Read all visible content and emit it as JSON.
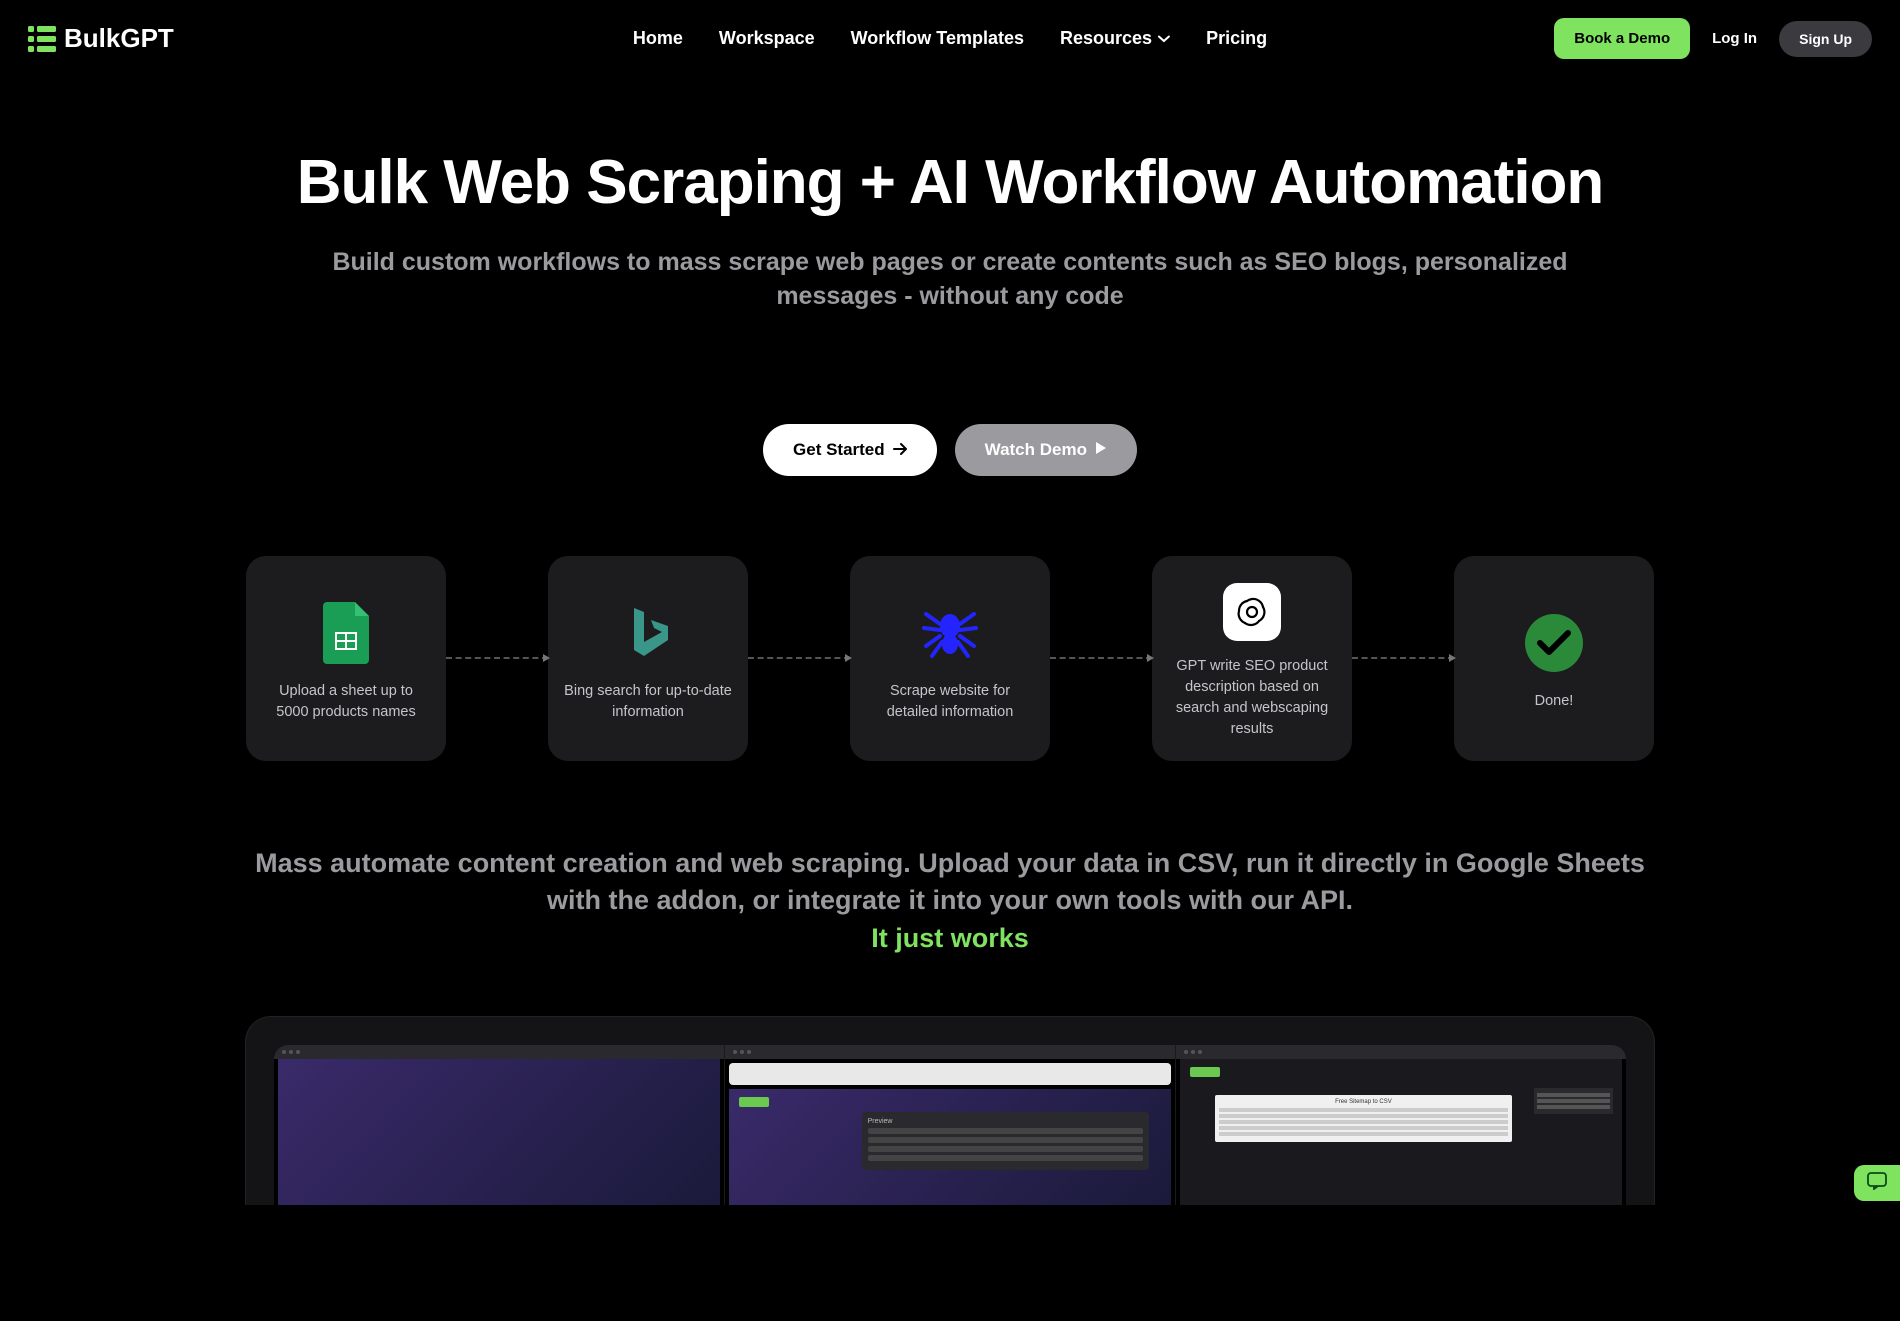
{
  "brand": "BulkGPT",
  "nav": {
    "home": "Home",
    "workspace": "Workspace",
    "templates": "Workflow Templates",
    "resources": "Resources",
    "pricing": "Pricing"
  },
  "header_actions": {
    "book_demo": "Book a Demo",
    "login": "Log In",
    "signup": "Sign Up"
  },
  "hero": {
    "title": "Bulk Web Scraping + AI Workflow Automation",
    "subtitle": "Build custom workflows to mass scrape web pages or create contents such as SEO blogs, personalized messages - without any code",
    "cta_start": "Get Started",
    "cta_watch": "Watch Demo"
  },
  "flow": [
    {
      "label": "Upload a sheet up to 5000 products names"
    },
    {
      "label": "Bing search for up-to-date information"
    },
    {
      "label": "Scrape website for detailed information"
    },
    {
      "label": "GPT write SEO product description based on search and webscaping results"
    },
    {
      "label": "Done!"
    }
  ],
  "mid": {
    "text": "Mass automate content creation and web scraping. Upload your data in CSV, run it directly in Google Sheets with the addon, or integrate it into your own tools with our API.",
    "highlight": "It just works"
  },
  "mock": {
    "preview": "Preview",
    "csv_title": "Free Sitemap to CSV"
  }
}
